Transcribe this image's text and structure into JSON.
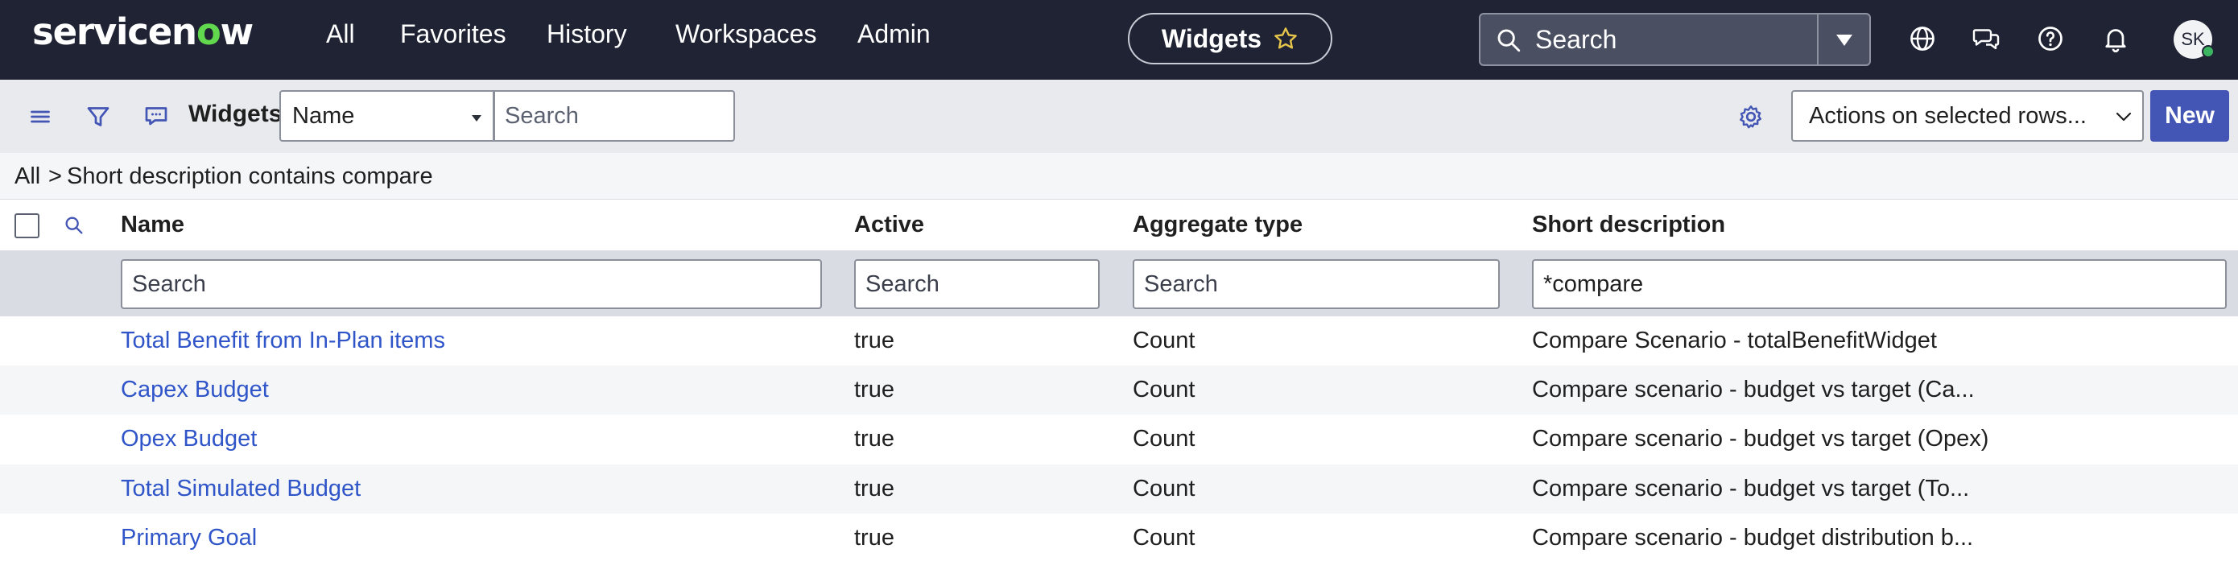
{
  "banner": {
    "logo_prefix": "servicen",
    "logo_o": "o",
    "logo_suffix": "w",
    "nav": [
      "All",
      "Favorites",
      "History",
      "Workspaces",
      "Admin"
    ],
    "context_pill": "Widgets",
    "search_placeholder": "Search",
    "avatar_initials": "SK"
  },
  "toolbar": {
    "title": "Widgets",
    "field_select": "Name",
    "search_placeholder": "Search",
    "actions_select": "Actions on selected rows...",
    "new_button": "New"
  },
  "breadcrumb": {
    "root": "All",
    "separator": ">",
    "condition": "Short description contains compare"
  },
  "table": {
    "columns": [
      "Name",
      "Active",
      "Aggregate type",
      "Short description"
    ],
    "filters": {
      "name_placeholder": "Search",
      "active_placeholder": "Search",
      "aggregate_placeholder": "Search",
      "short_description_value": "*compare"
    },
    "rows": [
      {
        "name": "Total Benefit from In-Plan items",
        "active": "true",
        "aggregate": "Count",
        "description": "Compare Scenario - totalBenefitWidget"
      },
      {
        "name": "Capex Budget",
        "active": "true",
        "aggregate": "Count",
        "description": "Compare scenario - budget vs target (Ca..."
      },
      {
        "name": "Opex Budget",
        "active": "true",
        "aggregate": "Count",
        "description": "Compare scenario - budget vs target (Opex)"
      },
      {
        "name": "Total Simulated Budget",
        "active": "true",
        "aggregate": "Count",
        "description": "Compare scenario - budget vs target (To..."
      },
      {
        "name": "Primary Goal",
        "active": "true",
        "aggregate": "Count",
        "description": "Compare scenario - budget distribution b..."
      }
    ]
  },
  "colors": {
    "banner_bg": "#1f2333",
    "accent_green": "#62d84e",
    "link_blue": "#2f55c9",
    "new_button": "#4456b5"
  }
}
